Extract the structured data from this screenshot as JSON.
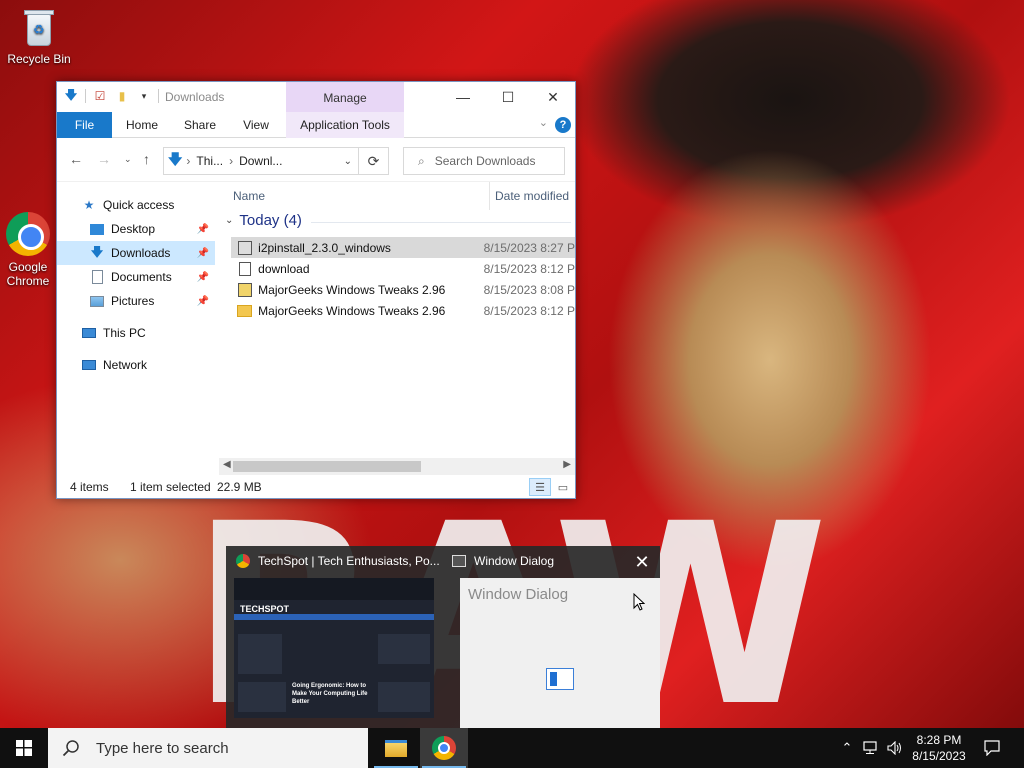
{
  "desktop": {
    "wallpaper_text": "RAW",
    "icons": [
      {
        "label": "Recycle Bin"
      },
      {
        "label": "Google Chrome"
      }
    ]
  },
  "explorer": {
    "title": "Downloads",
    "manage_tab": "Manage",
    "controls": {
      "minimize": "—",
      "maximize": "☐",
      "close": "✕"
    },
    "ribbon_tabs": [
      "File",
      "Home",
      "Share",
      "View",
      "Application Tools"
    ],
    "help": "?",
    "address": {
      "part1": "Thi...",
      "part2": "Downl..."
    },
    "search_placeholder": "Search Downloads",
    "nav": [
      {
        "label": "Quick access",
        "icon": "star-icon"
      },
      {
        "label": "Desktop",
        "icon": "desktop-folder-icon",
        "pinned": true
      },
      {
        "label": "Downloads",
        "icon": "download-folder-icon",
        "pinned": true,
        "selected": true
      },
      {
        "label": "Documents",
        "icon": "documents-folder-icon",
        "pinned": true
      },
      {
        "label": "Pictures",
        "icon": "pictures-folder-icon",
        "pinned": true
      },
      {
        "label": "This PC",
        "icon": "computer-icon"
      },
      {
        "label": "Network",
        "icon": "network-icon"
      }
    ],
    "columns": {
      "name": "Name",
      "date": "Date modified"
    },
    "group": "Today (4)",
    "files": [
      {
        "name": "i2pinstall_2.3.0_windows",
        "date": "8/15/2023 8:27 P",
        "icon": "installer-icon",
        "selected": true
      },
      {
        "name": "download",
        "date": "8/15/2023 8:12 P",
        "icon": "file-icon"
      },
      {
        "name": "MajorGeeks Windows Tweaks 2.96",
        "date": "8/15/2023 8:08 P",
        "icon": "zip-icon"
      },
      {
        "name": "MajorGeeks Windows Tweaks 2.96",
        "date": "8/15/2023 8:12 P",
        "icon": "folder-icon"
      }
    ],
    "status": {
      "count": "4 items",
      "selected": "1 item selected",
      "size": "22.9 MB"
    }
  },
  "thumbnails": [
    {
      "title": "TechSpot | Tech Enthusiasts, Po...",
      "icon": "chrome-icon",
      "preview": {
        "logo": "TECHSPOT",
        "headline": "Going Ergonomic: How to Make Your Computing Life Better"
      }
    },
    {
      "title": "Window Dialog",
      "icon": "dialog-icon",
      "preview": {
        "title": "Window Dialog"
      }
    }
  ],
  "thumb_close": "✕",
  "taskbar": {
    "search_placeholder": "Type here to search",
    "time": "8:28 PM",
    "date": "8/15/2023"
  }
}
